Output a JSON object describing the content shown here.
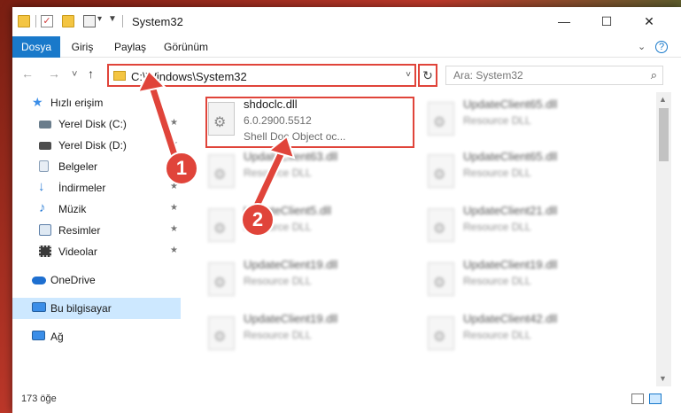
{
  "window": {
    "title": "System32",
    "minimize_glyph": "—",
    "maximize_glyph": "☐",
    "close_glyph": "✕"
  },
  "quick_access": {
    "check_glyph": "✓",
    "dropdown_glyph": "▾",
    "customize_glyph": "▼"
  },
  "ribbon": {
    "tabs": [
      "Dosya",
      "Giriş",
      "Paylaş",
      "Görünüm"
    ],
    "collapse_glyph": "⌄",
    "help_glyph": "?"
  },
  "nav": {
    "back_glyph": "←",
    "forward_glyph": "→",
    "recent_glyph": "˅",
    "up_glyph": "↑",
    "address": "C:\\Windows\\System32",
    "address_chevron": "˅",
    "refresh_glyph": "↻",
    "search_placeholder": "Ara: System32",
    "search_glyph": "⌕"
  },
  "sidebar": {
    "pin_glyph": "★",
    "items": [
      {
        "label": "Hızlı erişim",
        "icon": "star-icon",
        "color": "#3b8ee8"
      },
      {
        "label": "Yerel Disk (C:)",
        "icon": "drive-icon",
        "color": "#6a7d8c",
        "pinned": true
      },
      {
        "label": "Yerel Disk (D:)",
        "icon": "drive-icon",
        "color": "#4d4d4d",
        "pinned": true
      },
      {
        "label": "Belgeler",
        "icon": "document-icon",
        "color": "#cfd8e3",
        "pinned": true
      },
      {
        "label": "İndirmeler",
        "icon": "download-icon",
        "color": "#2f7fd6",
        "pinned": true
      },
      {
        "label": "Müzik",
        "icon": "music-icon",
        "color": "#2f7fd6",
        "pinned": true
      },
      {
        "label": "Resimler",
        "icon": "pictures-icon",
        "color": "#7aa0c8",
        "pinned": true
      },
      {
        "label": "Videolar",
        "icon": "video-icon",
        "color": "#3a3a3a",
        "pinned": true
      },
      {
        "label": "OneDrive",
        "icon": "cloud-icon",
        "color": "#1e6fd0"
      },
      {
        "label": "Bu bilgisayar",
        "icon": "computer-icon",
        "color": "#3b8ee8",
        "selected": true
      },
      {
        "label": "Ağ",
        "icon": "network-icon",
        "color": "#3b8ee8"
      }
    ]
  },
  "files": [
    {
      "name": "shdoclc.dll",
      "line2": "6.0.2900.5512",
      "line3": "Shell Doc Object oc...",
      "highlighted": true
    },
    {
      "name": "UpdateClient65.dll",
      "line2": "Resource DLL"
    },
    {
      "name": "UpdateClient63.dll",
      "line2": "Resource DLL"
    },
    {
      "name": "UpdateClient65.dll",
      "line2": "Resource DLL"
    },
    {
      "name": "UpdateClient5.dll",
      "line2": "Resource DLL"
    },
    {
      "name": "UpdateClient21.dll",
      "line2": "Resource DLL"
    },
    {
      "name": "UpdateClient19.dll",
      "line2": "Resource DLL"
    },
    {
      "name": "UpdateClient19.dll",
      "line2": "Resource DLL"
    },
    {
      "name": "UpdateClient19.dll",
      "line2": "Resource DLL"
    },
    {
      "name": "UpdateClient42.dll",
      "line2": "Resource DLL"
    }
  ],
  "scrollbar": {
    "up_glyph": "▲",
    "down_glyph": "▼"
  },
  "status": {
    "item_count": "173 öğe"
  },
  "callouts": [
    "1",
    "2"
  ],
  "colors": {
    "accent": "#1979ca",
    "highlight": "#e0443a",
    "selection": "#cde8ff"
  }
}
